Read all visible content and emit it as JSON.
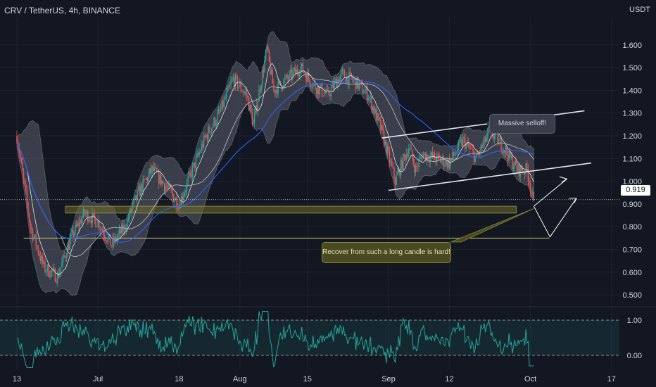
{
  "header": {
    "title": "CRV / TetherUS, 4h, BINANCE",
    "unit": "USDT"
  },
  "callouts": {
    "selloff": "Massive selloff!",
    "recover": "Recover from such a long candle is hard!"
  },
  "colors": {
    "background": "#131722",
    "grid": "#1e222d",
    "up_candle": "#26a69a",
    "down_candle": "#ef5350",
    "bands_fill": "#6b6f7c",
    "ma_blue": "#2962ff",
    "support_zone": "#8a8a3a",
    "rsi_line": "#26a69a",
    "trendlines": "#e0e3eb"
  },
  "chart_data": [
    {
      "type": "candlestick",
      "title": "CRV / TetherUS, 4h, BINANCE",
      "ylabel": "USDT",
      "ylim": [
        0.46,
        1.72
      ],
      "x_ticks": [
        "13",
        "Jul",
        "18",
        "Aug",
        "15",
        "Sep",
        "12",
        "Oct",
        "17"
      ],
      "y_ticks": [
        0.5,
        0.6,
        0.7,
        0.8,
        0.9,
        1.0,
        1.1,
        1.2,
        1.3,
        1.4,
        1.5,
        1.6
      ],
      "last_price": "0.919",
      "price_path_days": [
        [
          0,
          1.2
        ],
        [
          2,
          0.8
        ],
        [
          4,
          0.62
        ],
        [
          6,
          0.58
        ],
        [
          8,
          0.75
        ],
        [
          10,
          0.86
        ],
        [
          12,
          0.82
        ],
        [
          14,
          0.72
        ],
        [
          16,
          0.8
        ],
        [
          18,
          0.95
        ],
        [
          20,
          1.05
        ],
        [
          22,
          0.98
        ],
        [
          24,
          0.9
        ],
        [
          26,
          1.05
        ],
        [
          28,
          1.2
        ],
        [
          30,
          1.3
        ],
        [
          32,
          1.45
        ],
        [
          34,
          1.38
        ],
        [
          35,
          1.25
        ],
        [
          36,
          1.42
        ],
        [
          37,
          1.58
        ],
        [
          38,
          1.4
        ],
        [
          40,
          1.45
        ],
        [
          42,
          1.5
        ],
        [
          44,
          1.42
        ],
        [
          46,
          1.38
        ],
        [
          48,
          1.47
        ],
        [
          50,
          1.44
        ],
        [
          52,
          1.38
        ],
        [
          54,
          1.22
        ],
        [
          56,
          1.0
        ],
        [
          57,
          1.08
        ],
        [
          58,
          1.15
        ],
        [
          59,
          1.05
        ],
        [
          60,
          1.12
        ],
        [
          62,
          1.1
        ],
        [
          64,
          1.08
        ],
        [
          66,
          1.18
        ],
        [
          68,
          1.1
        ],
        [
          70,
          1.22
        ],
        [
          72,
          1.15
        ],
        [
          74,
          1.05
        ],
        [
          75.5,
          1.05
        ],
        [
          76.5,
          0.9
        ]
      ],
      "support_zone": [
        0.86,
        0.89
      ],
      "support_line": 0.75,
      "channel": {
        "upper": [
          [
            54,
            1.19
          ],
          [
            84,
            1.31
          ]
        ],
        "lower": [
          [
            55,
            0.96
          ],
          [
            85,
            1.08
          ]
        ]
      }
    },
    {
      "type": "line",
      "series": [
        {
          "name": "",
          "values": []
        }
      ],
      "ylim": [
        -0.4,
        1.3
      ],
      "y_ticks": [
        0.0,
        1.0
      ],
      "band": [
        0.0,
        1.0
      ]
    }
  ]
}
